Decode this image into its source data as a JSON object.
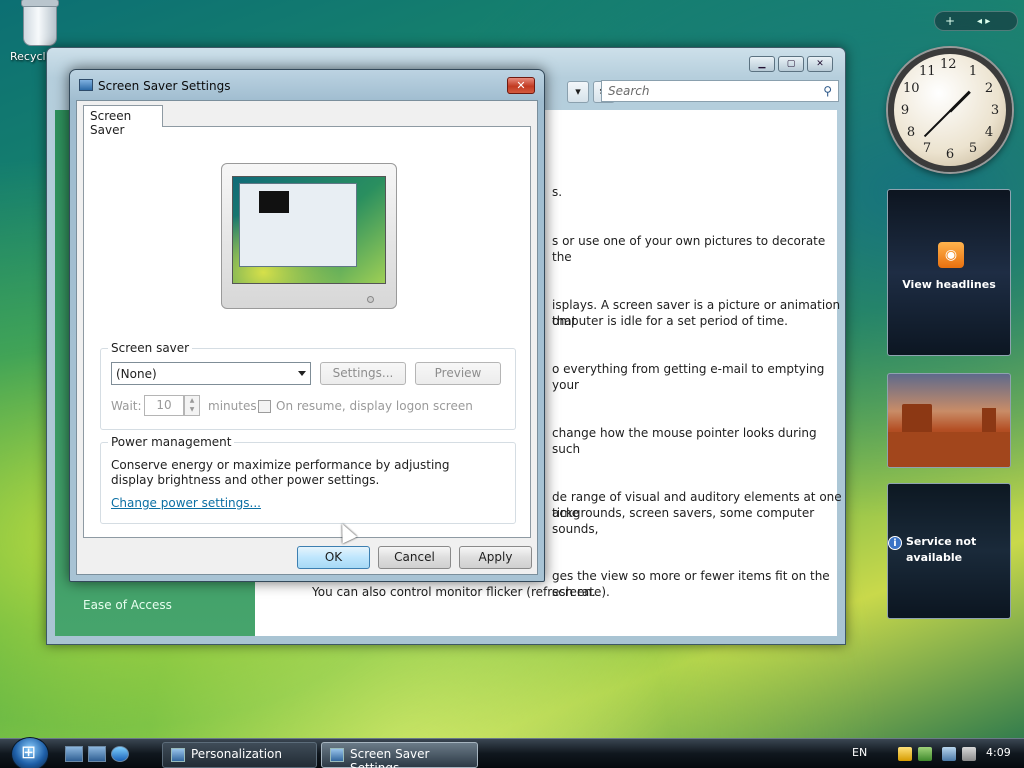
{
  "desktop": {
    "recycle_bin_label": "Recycle"
  },
  "bg_window": {
    "search_placeholder": "Search",
    "left_nav_item": "Ease of Access",
    "paragraph_fragments": [
      "s.",
      "s or use one of your own pictures to decorate the",
      "isplays. A screen saver is a picture or animation that",
      "omputer is idle for a set period of time.",
      "o everything from getting e-mail to emptying your",
      "change how the mouse pointer looks during such",
      "de range of visual and auditory elements at one time",
      "ackgrounds, screen savers, some computer sounds,",
      "ges the view so more or fewer items fit on the screen.",
      "You can also control monitor flicker (refresh rate)."
    ]
  },
  "dialog": {
    "title": "Screen Saver Settings",
    "close_label": "✕",
    "tab_label": "Screen Saver",
    "screen_saver_group": {
      "legend": "Screen saver",
      "selected": "(None)",
      "settings_label": "Settings...",
      "preview_label": "Preview",
      "wait_label": "Wait:",
      "wait_value": "10",
      "minutes_label": "minutes",
      "resume_label": "On resume, display logon screen"
    },
    "power_group": {
      "legend": "Power management",
      "description": "Conserve energy or maximize performance by adjusting display brightness and other power settings.",
      "link": "Change power settings..."
    },
    "buttons": {
      "ok": "OK",
      "cancel": "Cancel",
      "apply": "Apply"
    }
  },
  "sidebar": {
    "add_label": "+",
    "nav_label": "◂ ▸",
    "clock_numbers": [
      "12",
      "1",
      "2",
      "3",
      "4",
      "5",
      "6",
      "7",
      "8",
      "9",
      "10",
      "11"
    ],
    "news_label": "View headlines",
    "weather_label_line1": "Service not",
    "weather_label_line2": "available"
  },
  "taskbar": {
    "items": [
      {
        "label": "Personalization"
      },
      {
        "label": "Screen Saver Settings"
      }
    ],
    "language": "EN",
    "time": "4:09"
  },
  "colors": {
    "link": "#0b6fa4",
    "close_red": "#c23a22",
    "default_button": "#bee6fd"
  }
}
